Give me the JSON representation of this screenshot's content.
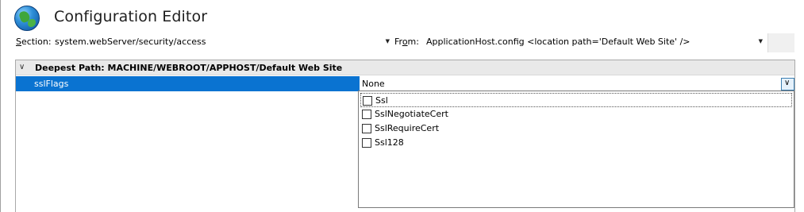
{
  "header": {
    "title": "Configuration Editor",
    "icon": "globe-icon"
  },
  "section": {
    "label": "Section:",
    "value": "system.webServer/security/access"
  },
  "from": {
    "label": "From:",
    "value": "ApplicationHost.config <location path='Default Web Site' />"
  },
  "grid": {
    "group_header": "Deepest Path: MACHINE/WEBROOT/APPHOST/Default Web Site",
    "rows": [
      {
        "name": "sslFlags",
        "value": "None"
      }
    ]
  },
  "dropdown": {
    "options": [
      {
        "label": "Ssl",
        "checked": false
      },
      {
        "label": "SslNegotiateCert",
        "checked": false
      },
      {
        "label": "SslRequireCert",
        "checked": false
      },
      {
        "label": "Ssl128",
        "checked": false
      }
    ]
  },
  "colors": {
    "selection": "#0a73d1",
    "header_bg": "#e9e9e9"
  }
}
